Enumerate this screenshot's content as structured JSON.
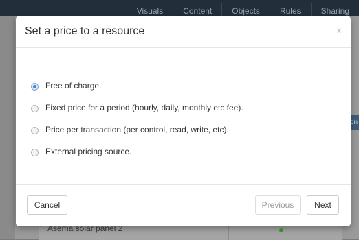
{
  "background": {
    "nav_items": [
      "Visuals",
      "Content",
      "Objects",
      "Rules",
      "Sharing"
    ],
    "table_row_text": "Asema solar panel 2",
    "side_tab_text": "on"
  },
  "modal": {
    "title": "Set a price to a resource",
    "close_symbol": "×",
    "options": [
      {
        "label": "Free of charge.",
        "checked": true
      },
      {
        "label": "Fixed price for a period (hourly, daily, monthly etc fee).",
        "checked": false
      },
      {
        "label": "Price per transaction (per control, read, write, etc).",
        "checked": false
      },
      {
        "label": "External pricing source.",
        "checked": false
      }
    ],
    "buttons": {
      "cancel": "Cancel",
      "previous": "Previous",
      "next": "Next"
    }
  },
  "colors": {
    "radio_selected": "#3b88d8",
    "status_dot": "#3da02a"
  }
}
